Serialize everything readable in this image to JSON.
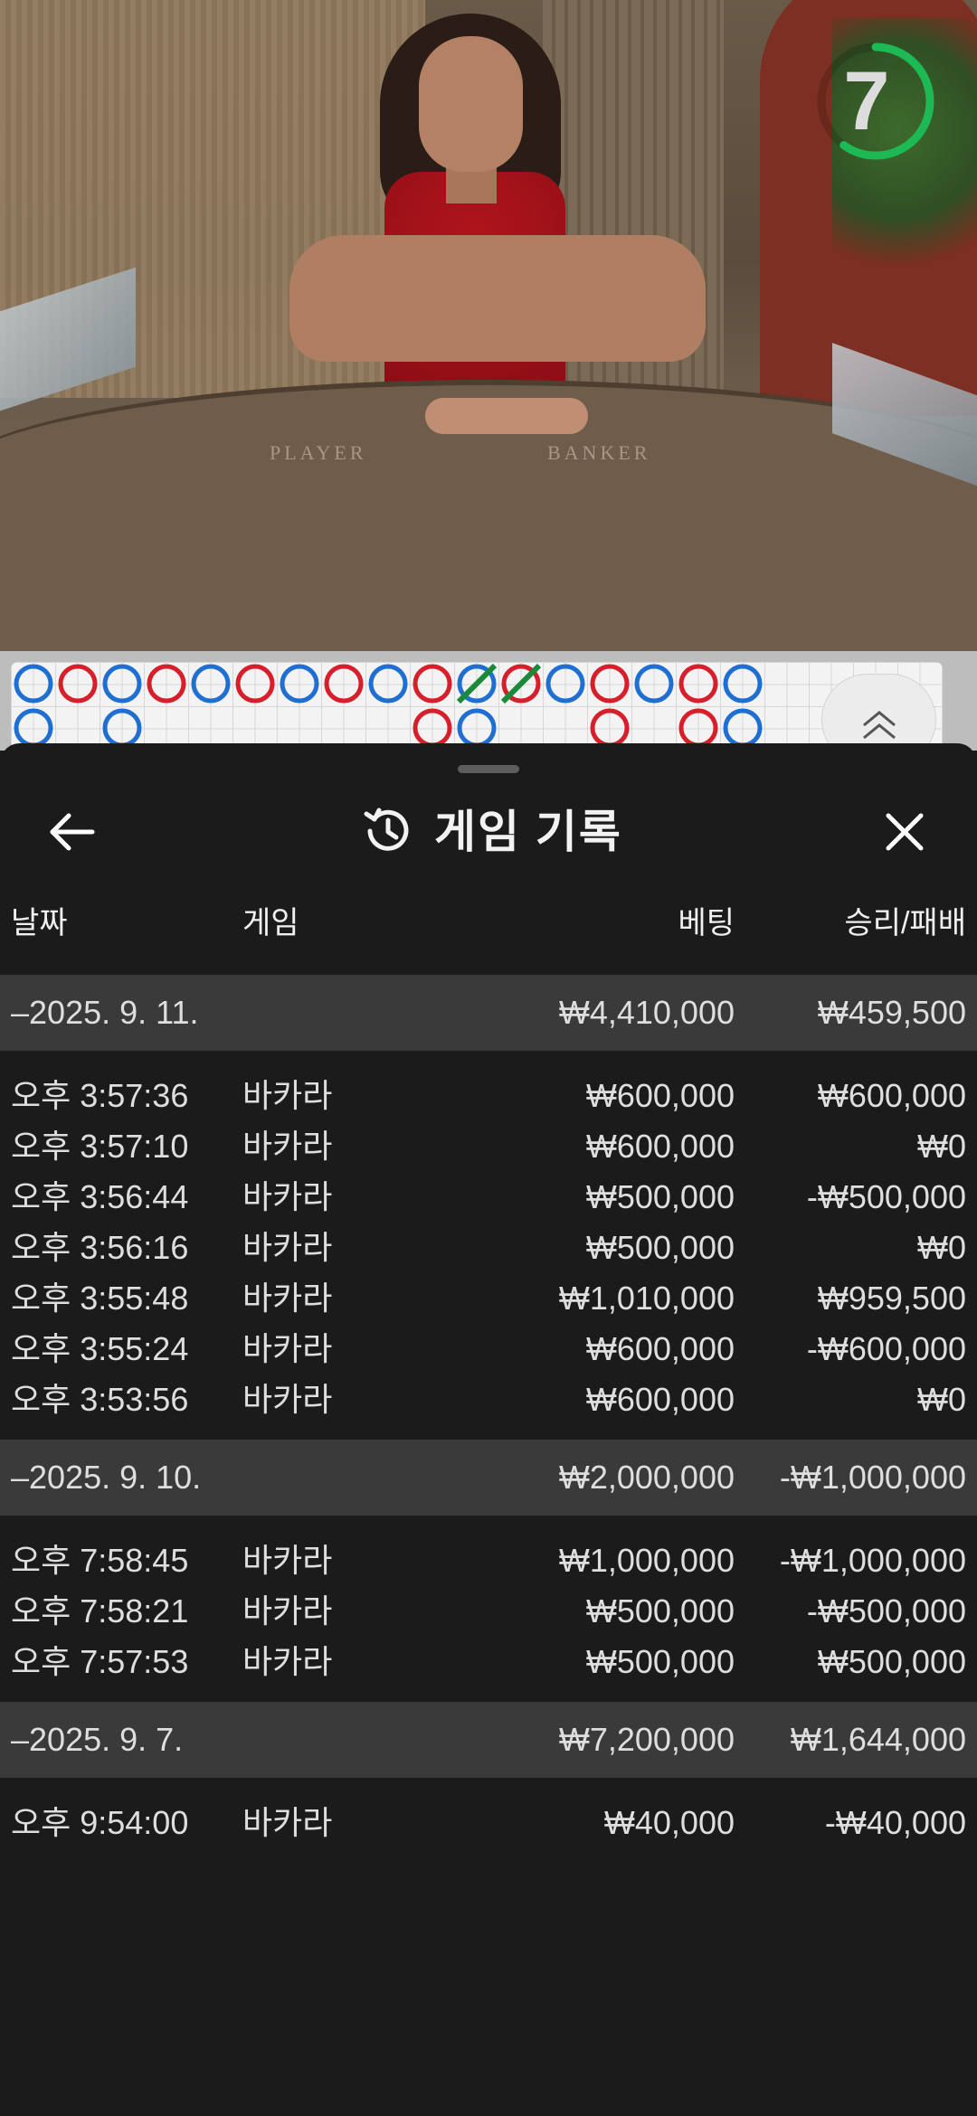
{
  "video": {
    "table_labels": [
      "PLAYER",
      "BANKER"
    ],
    "countdown": "7",
    "countdown_progress": 0.6,
    "colors": {
      "countdown_ring": "#1db954",
      "player": "#1e6fd1",
      "banker": "#d61f2a"
    }
  },
  "roadmap": {
    "columns": [
      [
        "P",
        "P"
      ],
      [
        "B"
      ],
      [
        "P",
        "P"
      ],
      [
        "B"
      ],
      [
        "P"
      ],
      [
        "B"
      ],
      [
        "P"
      ],
      [
        "B"
      ],
      [
        "P"
      ],
      [
        "B",
        "B"
      ],
      [
        "P",
        "P"
      ],
      [
        "B"
      ],
      [
        "P"
      ],
      [
        "B",
        "B"
      ],
      [
        "P"
      ],
      [
        "B",
        "B"
      ],
      [
        "P",
        "P"
      ]
    ],
    "tie_marks_on_columns": [
      10,
      11
    ],
    "expand_icon": "double-chevron-up-icon"
  },
  "sheet": {
    "title": "게임 기록",
    "title_icon": "history-icon",
    "back_icon": "arrow-left-icon",
    "close_icon": "close-icon",
    "headers": {
      "date": "날짜",
      "game": "게임",
      "bet": "베팅",
      "result": "승리/패배"
    },
    "groups": [
      {
        "date": "–2025. 9. 11.",
        "total_bet": "₩4,410,000",
        "total_result": "₩459,500",
        "rows": [
          {
            "time": "오후 3:57:36",
            "game": "바카라",
            "bet": "₩600,000",
            "result": "₩600,000"
          },
          {
            "time": "오후 3:57:10",
            "game": "바카라",
            "bet": "₩600,000",
            "result": "₩0"
          },
          {
            "time": "오후 3:56:44",
            "game": "바카라",
            "bet": "₩500,000",
            "result": "-₩500,000"
          },
          {
            "time": "오후 3:56:16",
            "game": "바카라",
            "bet": "₩500,000",
            "result": "₩0"
          },
          {
            "time": "오후 3:55:48",
            "game": "바카라",
            "bet": "₩1,010,000",
            "result": "₩959,500"
          },
          {
            "time": "오후 3:55:24",
            "game": "바카라",
            "bet": "₩600,000",
            "result": "-₩600,000"
          },
          {
            "time": "오후 3:53:56",
            "game": "바카라",
            "bet": "₩600,000",
            "result": "₩0"
          }
        ]
      },
      {
        "date": "–2025. 9. 10.",
        "total_bet": "₩2,000,000",
        "total_result": "-₩1,000,000",
        "rows": [
          {
            "time": "오후 7:58:45",
            "game": "바카라",
            "bet": "₩1,000,000",
            "result": "-₩1,000,000"
          },
          {
            "time": "오후 7:58:21",
            "game": "바카라",
            "bet": "₩500,000",
            "result": "-₩500,000"
          },
          {
            "time": "오후 7:57:53",
            "game": "바카라",
            "bet": "₩500,000",
            "result": "₩500,000"
          }
        ]
      },
      {
        "date": "–2025. 9. 7.",
        "total_bet": "₩7,200,000",
        "total_result": "₩1,644,000",
        "rows": [
          {
            "time": "오후 9:54:00",
            "game": "바카라",
            "bet": "₩40,000",
            "result": "-₩40,000"
          }
        ]
      }
    ]
  }
}
